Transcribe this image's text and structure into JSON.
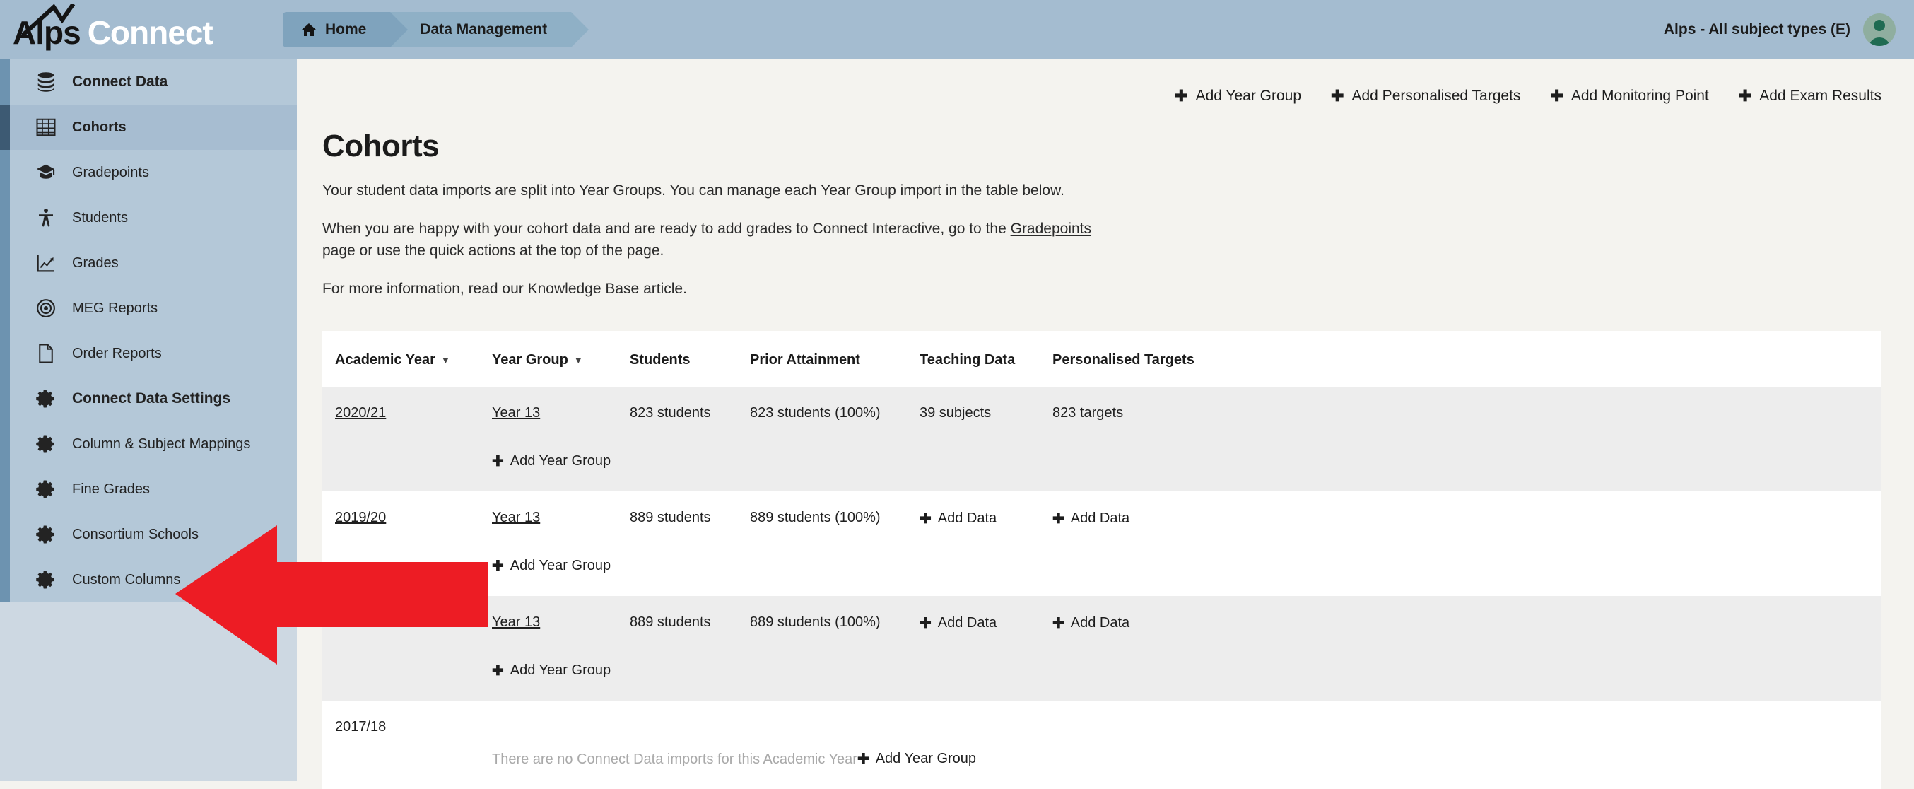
{
  "header": {
    "brand_alps": "Alps",
    "brand_connect": "Connect",
    "crumbs": [
      {
        "label": "Home",
        "icon": "home-icon"
      },
      {
        "label": "Data Management",
        "icon": null
      }
    ],
    "account_label": "Alps - All subject types (E)",
    "avatar_icon": "user-avatar-icon",
    "bar_color": "#a4bcd0"
  },
  "sidebar": {
    "items": [
      {
        "label": "Connect Data",
        "icon": "database-icon",
        "section": true,
        "active": false
      },
      {
        "label": "Cohorts",
        "icon": "table-grid-icon",
        "section": false,
        "active": true
      },
      {
        "label": "Gradepoints",
        "icon": "graduation-cap-icon",
        "section": false,
        "active": false
      },
      {
        "label": "Students",
        "icon": "student-person-icon",
        "section": false,
        "active": false
      },
      {
        "label": "Grades",
        "icon": "chart-line-icon",
        "section": false,
        "active": false
      },
      {
        "label": "MEG Reports",
        "icon": "target-icon",
        "section": false,
        "active": false
      },
      {
        "label": "Order Reports",
        "icon": "document-icon",
        "section": false,
        "active": false
      },
      {
        "label": "Connect Data Settings",
        "icon": "gear-icon",
        "section": true,
        "active": false
      },
      {
        "label": "Column & Subject Mappings",
        "icon": "gear-icon",
        "section": false,
        "active": false
      },
      {
        "label": "Fine Grades",
        "icon": "gear-icon",
        "section": false,
        "active": false
      },
      {
        "label": "Consortium Schools",
        "icon": "gear-icon",
        "section": false,
        "active": false
      },
      {
        "label": "Custom Columns",
        "icon": "gear-icon",
        "section": false,
        "active": false
      }
    ]
  },
  "quick_actions": [
    {
      "label": "Add Year Group",
      "plus": "✚"
    },
    {
      "label": "Add Personalised Targets",
      "plus": "✚"
    },
    {
      "label": "Add Monitoring Point",
      "plus": "✚"
    },
    {
      "label": "Add Exam Results",
      "plus": "✚"
    }
  ],
  "main": {
    "page_title": "Cohorts",
    "para1": "Your student data imports are split into Year Groups. You can manage each Year Group import in the table below.",
    "para2_a": "When you are happy with your cohort data and are ready to add grades to Connect Interactive, go to the ",
    "para2_link": "Gradepoints",
    "para2_b": " page or use the quick actions at the top of the page.",
    "para3": "For more information, read our Knowledge Base article."
  },
  "table": {
    "headers": [
      {
        "label": "Academic Year",
        "sortable": true
      },
      {
        "label": "Year Group",
        "sortable": true
      },
      {
        "label": "Students",
        "sortable": false
      },
      {
        "label": "Prior Attainment",
        "sortable": false
      },
      {
        "label": "Teaching Data",
        "sortable": false
      },
      {
        "label": "Personalised Targets",
        "sortable": false
      }
    ],
    "add_year_group_label": "Add Year Group",
    "add_data_label": "Add Data",
    "rows": [
      {
        "academic_year": "2020/21",
        "academic_year_link": true,
        "year_group": "Year 13",
        "students": "823 students",
        "prior_attainment": "823 students (100%)",
        "teaching_data": "39 subjects",
        "teaching_data_is_add": false,
        "personalised_targets": "823 targets",
        "personalised_targets_is_add": false,
        "empty_message": null,
        "shaded": true
      },
      {
        "academic_year": "2019/20",
        "academic_year_link": true,
        "year_group": "Year 13",
        "students": "889 students",
        "prior_attainment": "889 students (100%)",
        "teaching_data": "Add Data",
        "teaching_data_is_add": true,
        "personalised_targets": "Add Data",
        "personalised_targets_is_add": true,
        "empty_message": null,
        "shaded": false
      },
      {
        "academic_year": "",
        "academic_year_link": true,
        "year_group": "Year 13",
        "students": "889 students",
        "prior_attainment": "889 students (100%)",
        "teaching_data": "Add Data",
        "teaching_data_is_add": true,
        "personalised_targets": "Add Data",
        "personalised_targets_is_add": true,
        "empty_message": null,
        "shaded": true
      },
      {
        "academic_year": "2017/18",
        "academic_year_link": false,
        "year_group": null,
        "students": null,
        "prior_attainment": null,
        "teaching_data": null,
        "teaching_data_is_add": false,
        "personalised_targets": null,
        "personalised_targets_is_add": false,
        "empty_message": "There are no Connect Data imports for this Academic Year",
        "shaded": false
      }
    ]
  },
  "annotation": {
    "type": "red-arrow-left",
    "color": "#ed1c24",
    "points_at": "Custom Columns"
  }
}
